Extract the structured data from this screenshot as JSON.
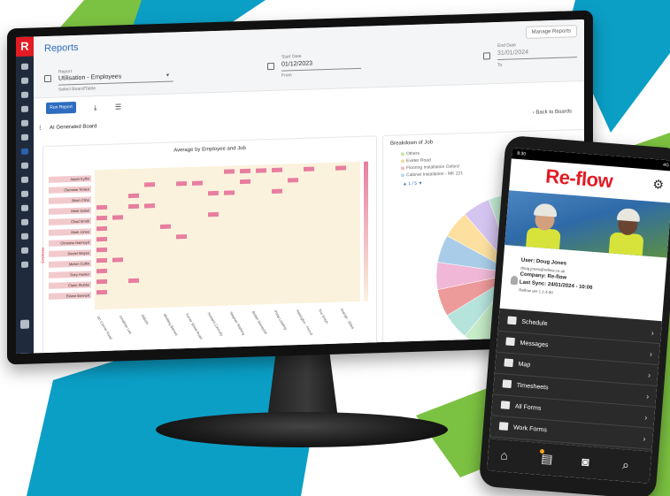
{
  "colors": {
    "brand_red": "#e31b23",
    "accent_blue": "#2d6cc0",
    "teal": "#0b9fc6",
    "green": "#7cc242",
    "navy": "#1f2b3d",
    "heat_pink": "#e77ea0",
    "heat_base": "#fbf2dd"
  },
  "monitor": {
    "logo": "R",
    "page_title": "Reports",
    "manage_reports": "Manage Reports",
    "report_label": "Report",
    "report_value": "Utilisation - Employees",
    "report_hint": "Select Board/Table",
    "start_label": "Start Date",
    "start_value": "01/12/2023",
    "start_hint": "From",
    "end_label": "End Date",
    "end_value": "31/01/2024",
    "end_hint": "To",
    "run_button": "Run Report",
    "board_title": "AI Generated Board",
    "back_link": "Back to Boards",
    "heatmap": {
      "title": "Average by Employee and Job",
      "y_axis_label": "Employee",
      "employees": [
        "Adam Kyffin",
        "Clemmie Timlen",
        "Brian Cline",
        "Mark Gabel",
        "Chad Smith",
        "Mark Jones",
        "Christine Naimoyd",
        "Daniel Wayes",
        "Melvin Coffin",
        "Gary Hunter",
        "Claire Stubbs",
        "Elaine Bennett"
      ],
      "jobs": [
        "Ian Conner Road",
        "Jonathan Lee",
        "Abbots",
        "Wolfang Barnes",
        "Turner Street Road",
        "Howard Connolly",
        "Stephen Stalking",
        "Brittan Stoneyhill",
        "Philip Leading",
        "Hartington - Ferrull",
        "The Greys",
        "Grange - Stites"
      ]
    },
    "pie": {
      "title": "Breakdown of Job",
      "legend": [
        "Others",
        "Exeter Road",
        "Flooring Installation Oxford",
        "Cabinet Installation - MK 221"
      ],
      "legend_colors": [
        "#c7e4a3",
        "#f5d9a0",
        "#f4b7c4",
        "#b7d8f4"
      ],
      "legend_page": "1 / 5",
      "slice_colors": [
        "#cfe8a9",
        "#bfe4ee",
        "#b9d3f3",
        "#c9c2ee",
        "#e6c1ec",
        "#f4bfd3",
        "#f7c7b6",
        "#f8dcae",
        "#f4eeb0",
        "#dff0b2",
        "#c6ecc8",
        "#b6e4dc",
        "#ec9a9a",
        "#f0b8d6",
        "#a9cde8",
        "#fde0a0",
        "#d4c4f0",
        "#c2ead3"
      ]
    }
  },
  "phone": {
    "status_time": "8:30",
    "status_right": "4G",
    "brand": "Re-flow",
    "user_line": "User: Doug Jones",
    "user_email": "doug.jones@reflow.co.uk",
    "company_line": "Company: Re-flow",
    "last_sync": "Last Sync: 24/01/2024 - 10:06",
    "version": "Reflow ver 1.1.4.90",
    "menu": [
      {
        "label": "Schedule",
        "icon": "schedule-icon"
      },
      {
        "label": "Messages",
        "icon": "messages-icon"
      },
      {
        "label": "Map",
        "icon": "map-pin-icon"
      },
      {
        "label": "Timesheets",
        "icon": "timesheets-icon"
      },
      {
        "label": "All Forms",
        "icon": "forms-icon"
      },
      {
        "label": "Work Forms",
        "icon": "work-forms-icon"
      }
    ],
    "bottom_nav": [
      "home-icon",
      "clipboard-icon",
      "camera-icon",
      "search-icon"
    ]
  }
}
